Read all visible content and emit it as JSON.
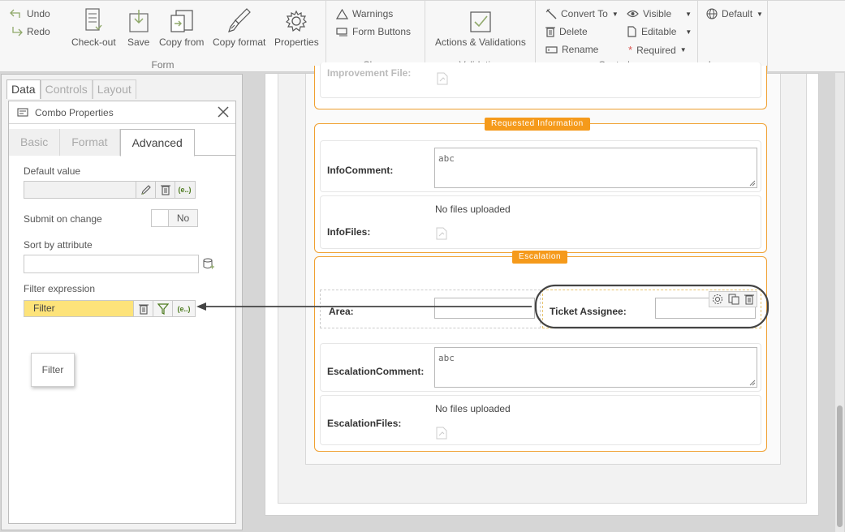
{
  "ribbon": {
    "undo_label": "Undo",
    "redo_label": "Redo",
    "form": {
      "label": "Form",
      "checkout_label": "Check-out",
      "save_label": "Save",
      "copy_from_label": "Copy from",
      "copy_format_label": "Copy format",
      "properties_label": "Properties"
    },
    "show": {
      "label": "Show",
      "warnings_label": "Warnings",
      "form_buttons_label": "Form Buttons"
    },
    "validation": {
      "label": "Validation",
      "actions_label": "Actions & Validations"
    },
    "controls": {
      "label": "Controls",
      "convert_to_label": "Convert To",
      "delete_label": "Delete",
      "rename_label": "Rename",
      "visible_label": "Visible",
      "editable_label": "Editable",
      "required_label": "Required"
    },
    "languages": {
      "label": "Languages",
      "default_label": "Default"
    }
  },
  "left_panel": {
    "tabs": [
      "Data",
      "Controls",
      "Layout"
    ],
    "active_tab": "Data",
    "props_title": "Combo Properties",
    "sub_tabs": [
      "Basic",
      "Format",
      "Advanced"
    ],
    "active_sub_tab": "Advanced",
    "default_value_label": "Default value",
    "submit_on_change_label": "Submit on change",
    "submit_on_change_value": "No",
    "sort_by_attribute_label": "Sort by attribute",
    "filter_expression_label": "Filter expression",
    "filter_value": "Filter",
    "tooltip_text": "Filter",
    "expr_button_label": "(e..)"
  },
  "form": {
    "improvement_file_label": "Improvement File:",
    "requested_info": {
      "title": "Requested Information",
      "info_comment_label": "InfoComment:",
      "info_comment_value": "abc",
      "info_files_label": "InfoFiles:",
      "info_files_text": "No files uploaded"
    },
    "escalation": {
      "title": "Escalation",
      "area_label": "Area:",
      "ticket_assignee_label": "Ticket Assignee:",
      "escalation_comment_label": "EscalationComment:",
      "escalation_comment_value": "abc",
      "escalation_files_label": "EscalationFiles:",
      "escalation_files_text": "No files uploaded"
    }
  },
  "colors": {
    "accent_orange": "#f59a1b",
    "filter_highlight": "#fde37a",
    "callout_outline": "#444444"
  }
}
